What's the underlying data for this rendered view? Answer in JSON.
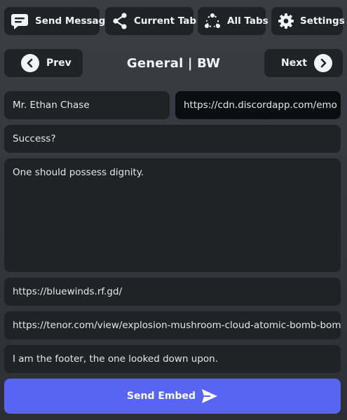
{
  "toolbar": {
    "send_message": {
      "label": "Send Message",
      "icon": "message-icon"
    },
    "current_tab": {
      "label": "Current Tab",
      "icon": "share-icon"
    },
    "all_tabs": {
      "label": "All Tabs",
      "icon": "network-icon"
    },
    "settings": {
      "label": "Settings",
      "icon": "gear-icon"
    }
  },
  "nav": {
    "prev_label": "Prev",
    "next_label": "Next",
    "channel_title": "General | BW"
  },
  "embed": {
    "author": "Mr. Ethan Chase",
    "avatar_url": "https://cdn.discordapp.com/emo",
    "title": "Success?",
    "description": "One should possess dignity.",
    "url": "https://bluewinds.rf.gd/",
    "image_url": "https://tenor.com/view/explosion-mushroom-cloud-atomic-bomb-bomb-",
    "footer": "I am the footer, the one looked down upon."
  },
  "send_button": {
    "label": "Send Embed",
    "icon": "send-icon"
  },
  "colors": {
    "background": "#36393f",
    "panel": "#202225",
    "accent": "#5865f2",
    "text": "#f2f3f5"
  }
}
